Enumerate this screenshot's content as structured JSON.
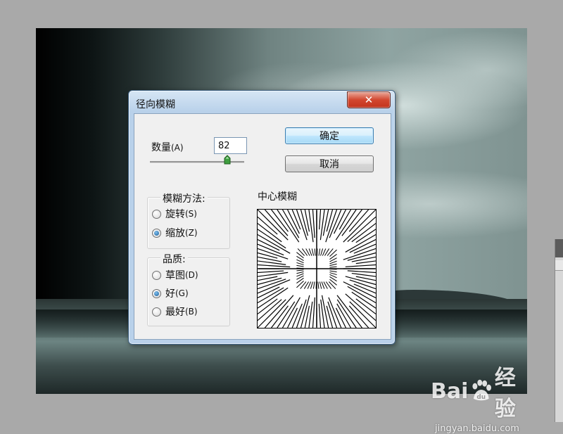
{
  "dialog": {
    "title": "径向模糊",
    "close_symbol": "✕"
  },
  "amount": {
    "label": "数量",
    "shortcut": "(A)",
    "value": "82",
    "min": 1,
    "max": 100
  },
  "buttons": {
    "ok": "确定",
    "cancel": "取消"
  },
  "blur_method": {
    "title": "模糊方法:",
    "options": [
      {
        "label": "旋转",
        "shortcut": "(S)",
        "checked": false
      },
      {
        "label": "缩放",
        "shortcut": "(Z)",
        "checked": true
      }
    ]
  },
  "quality": {
    "title": "品质:",
    "options": [
      {
        "label": "草图",
        "shortcut": "(D)",
        "checked": false
      },
      {
        "label": "好",
        "shortcut": "(G)",
        "checked": true
      },
      {
        "label": "最好",
        "shortcut": "(B)",
        "checked": false
      }
    ]
  },
  "preview": {
    "label": "中心模糊"
  },
  "watermark": {
    "brand_left": "Bai",
    "brand_right": "经验",
    "site": "jingyan.baidu.com",
    "paw_text": "du"
  },
  "colors": {
    "titlebar": "#b9d1ea",
    "close": "#c3341d",
    "ok_button": "#bee6fd"
  }
}
